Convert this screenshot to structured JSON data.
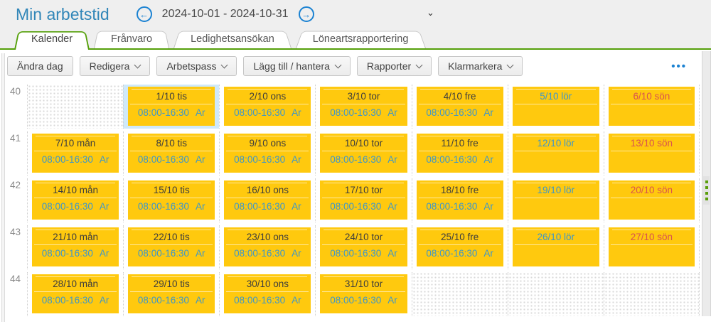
{
  "header": {
    "title": "Min arbetstid",
    "date_range": "2024-10-01 - 2024-10-31",
    "prev_icon": "arrow-left-circle-icon",
    "next_icon": "arrow-right-circle-icon",
    "prev_glyph": "←",
    "next_glyph": "→",
    "collapse_glyph": "⌄"
  },
  "tabs": [
    {
      "label": "Kalender",
      "active": true
    },
    {
      "label": "Frånvaro",
      "active": false
    },
    {
      "label": "Ledighetsansökan",
      "active": false
    },
    {
      "label": "Löneartsrapportering",
      "active": false
    }
  ],
  "toolbar": {
    "buttons": [
      {
        "label": "Ändra dag",
        "dropdown": false
      },
      {
        "label": "Redigera",
        "dropdown": true
      },
      {
        "label": "Arbetspass",
        "dropdown": true
      },
      {
        "label": "Lägg till / hantera",
        "dropdown": true
      },
      {
        "label": "Rapporter",
        "dropdown": true
      },
      {
        "label": "Klarmarkera",
        "dropdown": true
      }
    ],
    "more_label": "•••"
  },
  "colors": {
    "accent_blue": "#1a82d2",
    "title_blue": "#3186b8",
    "tab_green": "#55a00a",
    "shift_yellow": "#ffc90e",
    "time_blue": "#3e97c8",
    "sunday_red": "#d9534f",
    "saturday_blue": "#3e97c8",
    "selection_blue": "#cfe9fa"
  },
  "calendar": {
    "weeks": [
      {
        "number": "40",
        "days": [
          {
            "type": "blank"
          },
          {
            "type": "shift",
            "date": "1/10 tis",
            "kind": "wd",
            "time": "08:00-16:30",
            "code": "Ar",
            "selected": true
          },
          {
            "type": "shift",
            "date": "2/10 ons",
            "kind": "wd",
            "time": "08:00-16:30",
            "code": "Ar"
          },
          {
            "type": "shift",
            "date": "3/10 tor",
            "kind": "wd",
            "time": "08:00-16:30",
            "code": "Ar"
          },
          {
            "type": "shift",
            "date": "4/10 fre",
            "kind": "wd",
            "time": "08:00-16:30",
            "code": "Ar"
          },
          {
            "type": "date",
            "date": "5/10 lör",
            "kind": "sat"
          },
          {
            "type": "date",
            "date": "6/10 sön",
            "kind": "sun"
          }
        ]
      },
      {
        "number": "41",
        "days": [
          {
            "type": "shift",
            "date": "7/10 mån",
            "kind": "wd",
            "time": "08:00-16:30",
            "code": "Ar"
          },
          {
            "type": "shift",
            "date": "8/10 tis",
            "kind": "wd",
            "time": "08:00-16:30",
            "code": "Ar"
          },
          {
            "type": "shift",
            "date": "9/10 ons",
            "kind": "wd",
            "time": "08:00-16:30",
            "code": "Ar"
          },
          {
            "type": "shift",
            "date": "10/10 tor",
            "kind": "wd",
            "time": "08:00-16:30",
            "code": "Ar"
          },
          {
            "type": "shift",
            "date": "11/10 fre",
            "kind": "wd",
            "time": "08:00-16:30",
            "code": "Ar"
          },
          {
            "type": "date",
            "date": "12/10 lör",
            "kind": "sat"
          },
          {
            "type": "date",
            "date": "13/10 sön",
            "kind": "sun"
          }
        ]
      },
      {
        "number": "42",
        "days": [
          {
            "type": "shift",
            "date": "14/10 mån",
            "kind": "wd",
            "time": "08:00-16:30",
            "code": "Ar"
          },
          {
            "type": "shift",
            "date": "15/10 tis",
            "kind": "wd",
            "time": "08:00-16:30",
            "code": "Ar"
          },
          {
            "type": "shift",
            "date": "16/10 ons",
            "kind": "wd",
            "time": "08:00-16:30",
            "code": "Ar"
          },
          {
            "type": "shift",
            "date": "17/10 tor",
            "kind": "wd",
            "time": "08:00-16:30",
            "code": "Ar"
          },
          {
            "type": "shift",
            "date": "18/10 fre",
            "kind": "wd",
            "time": "08:00-16:30",
            "code": "Ar"
          },
          {
            "type": "date",
            "date": "19/10 lör",
            "kind": "sat"
          },
          {
            "type": "date",
            "date": "20/10 sön",
            "kind": "sun"
          }
        ]
      },
      {
        "number": "43",
        "days": [
          {
            "type": "shift",
            "date": "21/10 mån",
            "kind": "wd",
            "time": "08:00-16:30",
            "code": "Ar"
          },
          {
            "type": "shift",
            "date": "22/10 tis",
            "kind": "wd",
            "time": "08:00-16:30",
            "code": "Ar"
          },
          {
            "type": "shift",
            "date": "23/10 ons",
            "kind": "wd",
            "time": "08:00-16:30",
            "code": "Ar"
          },
          {
            "type": "shift",
            "date": "24/10 tor",
            "kind": "wd",
            "time": "08:00-16:30",
            "code": "Ar"
          },
          {
            "type": "shift",
            "date": "25/10 fre",
            "kind": "wd",
            "time": "08:00-16:30",
            "code": "Ar"
          },
          {
            "type": "date",
            "date": "26/10 lör",
            "kind": "sat"
          },
          {
            "type": "date",
            "date": "27/10 sön",
            "kind": "sun"
          }
        ]
      },
      {
        "number": "44",
        "days": [
          {
            "type": "shift",
            "date": "28/10 mån",
            "kind": "wd",
            "time": "08:00-16:30",
            "code": "Ar"
          },
          {
            "type": "shift",
            "date": "29/10 tis",
            "kind": "wd",
            "time": "08:00-16:30",
            "code": "Ar"
          },
          {
            "type": "shift",
            "date": "30/10 ons",
            "kind": "wd",
            "time": "08:00-16:30",
            "code": "Ar"
          },
          {
            "type": "shift",
            "date": "31/10 tor",
            "kind": "wd",
            "time": "08:00-16:30",
            "code": "Ar"
          },
          {
            "type": "blank"
          },
          {
            "type": "blank"
          },
          {
            "type": "blank"
          }
        ]
      }
    ]
  }
}
